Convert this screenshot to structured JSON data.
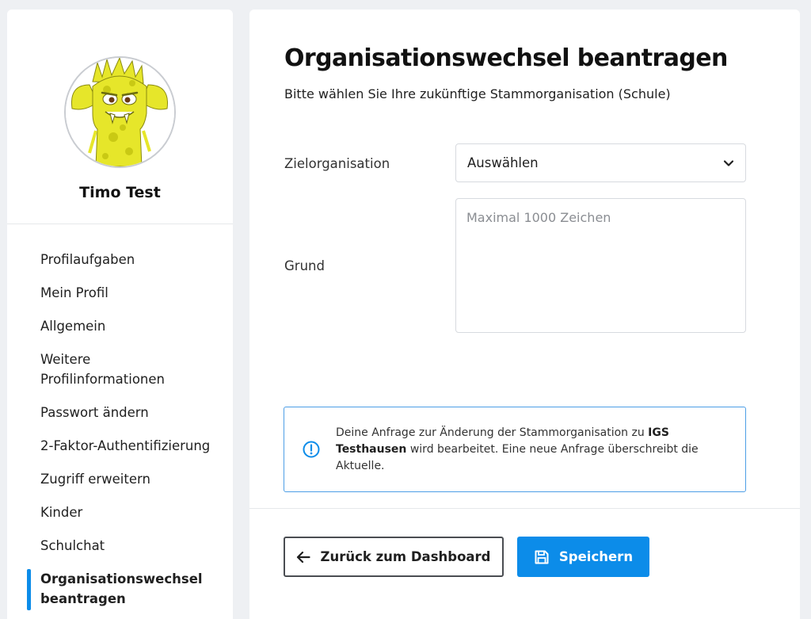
{
  "profile": {
    "name": "Timo Test"
  },
  "sidebar": {
    "items": [
      {
        "label": "Profilaufgaben"
      },
      {
        "label": "Mein Profil"
      },
      {
        "label": "Allgemein"
      },
      {
        "label": "Weitere Profilinformationen"
      },
      {
        "label": "Passwort ändern"
      },
      {
        "label": "2-Faktor-Authentifizierung"
      },
      {
        "label": "Zugriff erweitern"
      },
      {
        "label": "Kinder"
      },
      {
        "label": "Schulchat"
      },
      {
        "label": "Organisationswechsel beantragen"
      }
    ],
    "active_item": "Organisationswechsel beantragen"
  },
  "main": {
    "title": "Organisationswechsel beantragen",
    "subtitle": "Bitte wählen Sie Ihre zukünftige Stammorganisation (Schule)",
    "target_org": {
      "label": "Zielorganisation",
      "value": "Auswählen"
    },
    "reason": {
      "label": "Grund",
      "placeholder": "Maximal 1000 Zeichen",
      "value": ""
    },
    "info": {
      "text_before": "Deine Anfrage zur Änderung der Stammorganisation zu ",
      "org_name": "IGS Testhausen",
      "text_after": " wird bearbeitet. Eine neue Anfrage überschreibt die Aktuelle."
    },
    "buttons": {
      "back_label": "Zurück zum Dashboard",
      "save_label": "Speichern"
    }
  },
  "colors": {
    "accent": "#0c8ce9",
    "info_border": "#4d9ee6",
    "avatar_monster": "#e6e62a"
  },
  "icons": {
    "select": "chevron-down-icon",
    "info": "info-circle-icon",
    "back": "arrow-left-icon",
    "save": "floppy-disk-icon"
  }
}
